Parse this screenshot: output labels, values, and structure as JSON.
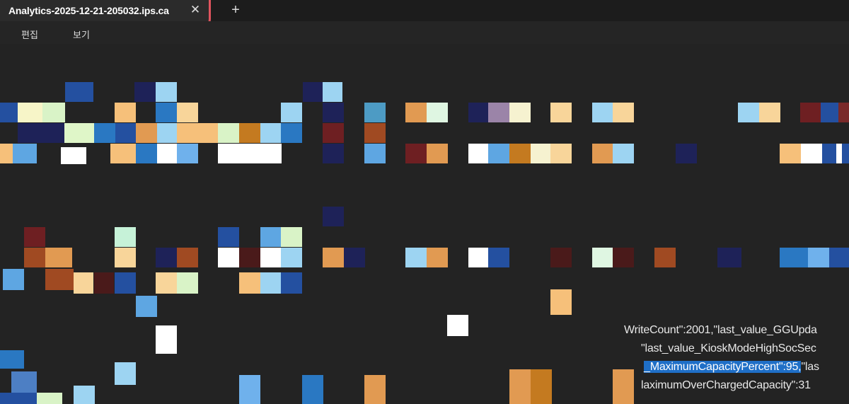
{
  "tab": {
    "title": "Analytics-2025-12-21-205032.ips.ca",
    "close_symbol": "✕",
    "new_tab_symbol": "+"
  },
  "menu": {
    "items": [
      "편집",
      "보기"
    ]
  },
  "code_lines": [
    {
      "before": "WriteCount\":2001,\"last_value_GGUpda",
      "selected": "",
      "after": ""
    },
    {
      "before": "\"last_value_KioskModeHighSocSec",
      "selected": "",
      "after": ""
    },
    {
      "before": "",
      "selected": "_MaximumCapacityPercent\":95,",
      "after": "\"las"
    },
    {
      "before": "laximumOverChargedCapacity\":31",
      "selected": "",
      "after": ""
    }
  ],
  "colors": {
    "background": "#232323",
    "tab_highlight": "#e0545e",
    "selection": "#1f6fc7"
  }
}
